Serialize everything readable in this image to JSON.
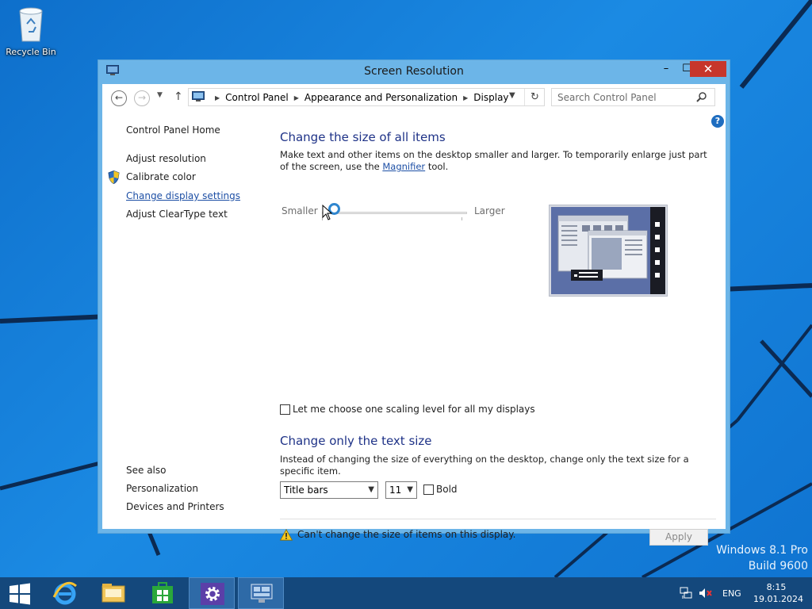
{
  "desktop": {
    "recycle_bin_label": "Recycle Bin",
    "watermark_line1": "Windows 8.1 Pro",
    "watermark_line2": "Build 9600"
  },
  "window": {
    "title": "Screen Resolution",
    "minimize_glyph": "–",
    "maximize_glyph": "☐",
    "close_glyph": "✕"
  },
  "navbar": {
    "breadcrumbs": [
      "Control Panel",
      "Appearance and Personalization",
      "Display"
    ],
    "search_placeholder": "Search Control Panel"
  },
  "left_pane": {
    "home": "Control Panel Home",
    "items": [
      "Adjust resolution",
      "Calibrate color",
      "Change display settings",
      "Adjust ClearType text"
    ],
    "see_also_heading": "See also",
    "see_also_items": [
      "Personalization",
      "Devices and Printers"
    ]
  },
  "main": {
    "section1_title": "Change the size of all items",
    "section1_text_before": "Make text and other items on the desktop smaller and larger. To temporarily enlarge just part of the screen, use the ",
    "section1_link": "Magnifier",
    "section1_text_after": " tool.",
    "slider_min_label": "Smaller",
    "slider_max_label": "Larger",
    "slider_value": 0,
    "checkbox_scaling_label": "Let me choose one scaling level for all my displays",
    "checkbox_scaling_checked": false,
    "section2_title": "Change only the text size",
    "section2_text": "Instead of changing the size of everything on the desktop, change only the text size for a specific item.",
    "item_select_value": "Title bars",
    "size_select_value": "11",
    "bold_label": "Bold",
    "bold_checked": false,
    "warning_text": "Can't change the size of items on this display.",
    "apply_label": "Apply"
  },
  "taskbar": {
    "language": "ENG",
    "time": "8:15",
    "date": "19.01.2024"
  },
  "colors": {
    "heading": "#1e3287",
    "link": "#1d4fa5",
    "taskbar": "#14487c",
    "close_button": "#c7362b"
  }
}
